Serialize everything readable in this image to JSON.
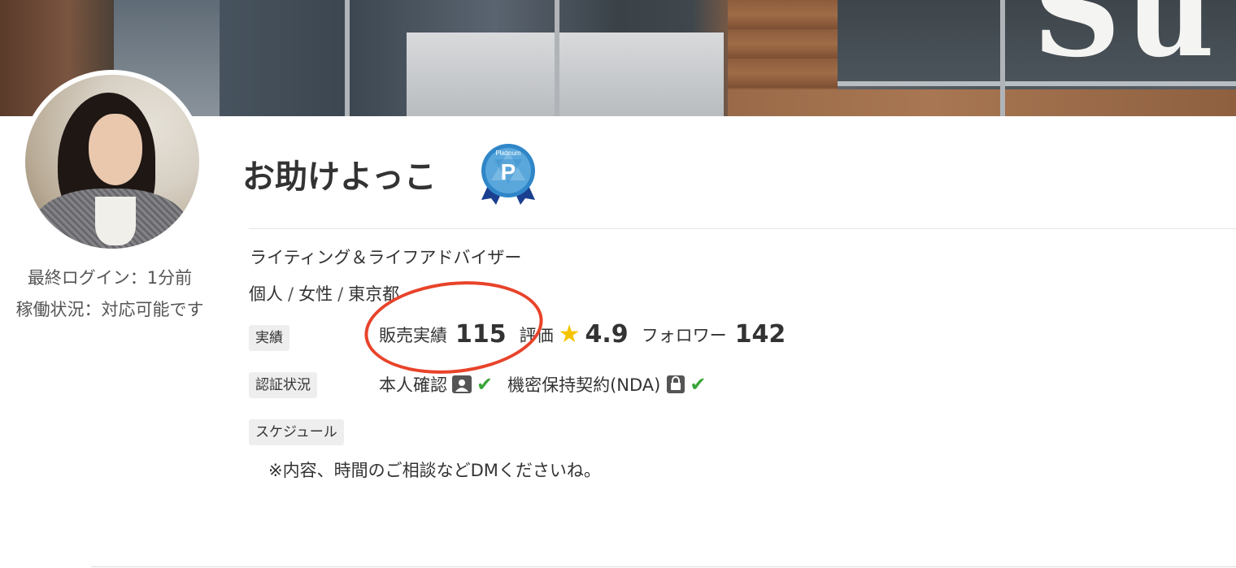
{
  "profile": {
    "name": "お助けよっこ",
    "badge_label": "Platinum",
    "badge_letter": "P",
    "title": "ライティング＆ライフアドバイザー",
    "meta": [
      "個人",
      "女性",
      "東京都"
    ],
    "meta_sep": "/",
    "last_login": "最終ログイン：1分前",
    "status": "稼働状況：対応可能です"
  },
  "cover": {
    "letters": "Su"
  },
  "stats": {
    "chip": "実績",
    "sales_label": "販売実績",
    "sales_value": "115",
    "rating_label": "評価",
    "rating_value": "4.9",
    "followers_label": "フォロワー",
    "followers_value": "142"
  },
  "verification": {
    "chip": "認証状況",
    "identity_label": "本人確認",
    "nda_label": "機密保持契約(NDA)"
  },
  "schedule": {
    "chip": "スケジュール",
    "note": "※内容、時間のご相談などDMくださいね。"
  },
  "colors": {
    "annotation": "#e8432a",
    "check": "#3aa63a",
    "star": "#f5c400",
    "badge_blue": "#2f86c8",
    "ribbon": "#1b3f8f"
  },
  "icons": [
    "star-icon",
    "person-card-icon",
    "lock-icon",
    "check-icon",
    "platinum-badge-icon"
  ]
}
